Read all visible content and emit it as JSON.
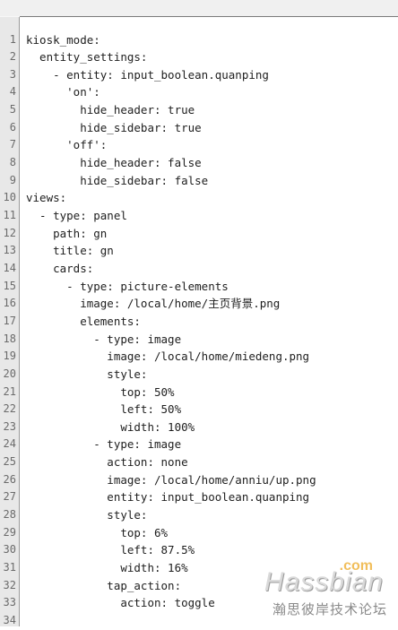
{
  "editor": {
    "lines": [
      {
        "n": "1",
        "text": "kiosk_mode:"
      },
      {
        "n": "2",
        "text": "  entity_settings:"
      },
      {
        "n": "3",
        "text": "    - entity: input_boolean.quanping"
      },
      {
        "n": "4",
        "text": "      'on':"
      },
      {
        "n": "5",
        "text": "        hide_header: true"
      },
      {
        "n": "6",
        "text": "        hide_sidebar: true"
      },
      {
        "n": "7",
        "text": "      'off':"
      },
      {
        "n": "8",
        "text": "        hide_header: false"
      },
      {
        "n": "9",
        "text": "        hide_sidebar: false"
      },
      {
        "n": "10",
        "text": "views:"
      },
      {
        "n": "11",
        "text": "  - type: panel"
      },
      {
        "n": "12",
        "text": "    path: gn"
      },
      {
        "n": "13",
        "text": "    title: gn"
      },
      {
        "n": "14",
        "text": "    cards:"
      },
      {
        "n": "15",
        "text": "      - type: picture-elements"
      },
      {
        "n": "16",
        "text": "        image: /local/home/主页背景.png"
      },
      {
        "n": "17",
        "text": "        elements:"
      },
      {
        "n": "18",
        "text": "          - type: image"
      },
      {
        "n": "19",
        "text": "            image: /local/home/miedeng.png"
      },
      {
        "n": "20",
        "text": "            style:"
      },
      {
        "n": "21",
        "text": "              top: 50%"
      },
      {
        "n": "22",
        "text": "              left: 50%"
      },
      {
        "n": "23",
        "text": "              width: 100%"
      },
      {
        "n": "24",
        "text": "          - type: image"
      },
      {
        "n": "25",
        "text": "            action: none"
      },
      {
        "n": "26",
        "text": "            image: /local/home/anniu/up.png"
      },
      {
        "n": "27",
        "text": "            entity: input_boolean.quanping"
      },
      {
        "n": "28",
        "text": "            style:"
      },
      {
        "n": "29",
        "text": "              top: 6%"
      },
      {
        "n": "30",
        "text": "              left: 87.5%"
      },
      {
        "n": "31",
        "text": "              width: 16%"
      },
      {
        "n": "32",
        "text": "            tap_action:"
      },
      {
        "n": "33",
        "text": "              action: toggle"
      },
      {
        "n": "34",
        "text": ""
      }
    ]
  },
  "watermark": {
    "com": ".com",
    "brand": "Hassbian",
    "subtitle": "瀚思彼岸技术论坛"
  },
  "colors": {
    "gutter_bg": "#e8e8e8",
    "code_bg": "#ffffff",
    "line_number": "#6b6b6b",
    "text": "#1e1e1e",
    "watermark_com": "#f0b84a"
  }
}
